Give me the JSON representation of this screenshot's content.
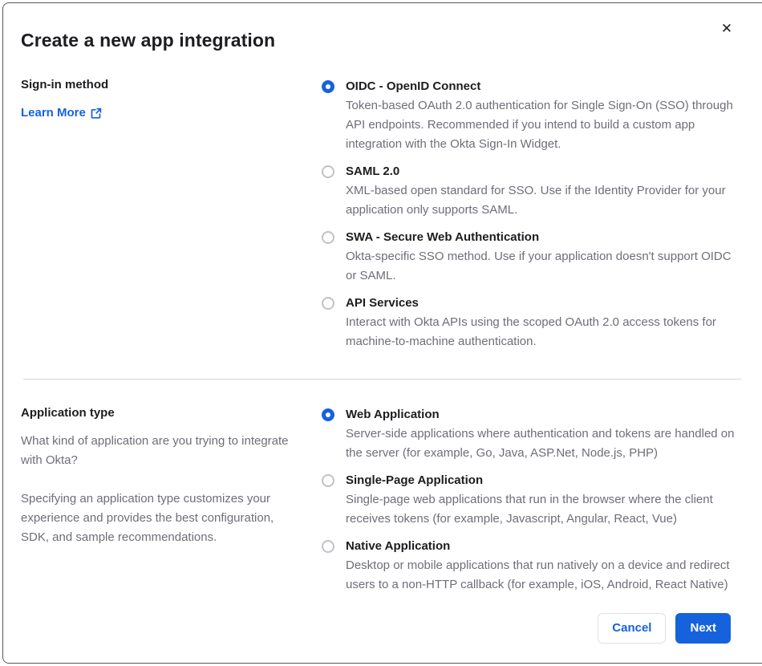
{
  "dialog": {
    "title": "Create a new app integration",
    "close_icon": "✕"
  },
  "colors": {
    "accent_blue": "#1662dd",
    "heading_text": "#1d1d21",
    "body_text": "#6e6e78",
    "divider": "#d7d7dc",
    "dialog_border": "#565660"
  },
  "signin": {
    "label": "Sign-in method",
    "learn_more_label": "Learn More",
    "options": [
      {
        "title": "OIDC - OpenID Connect",
        "description": "Token-based OAuth 2.0 authentication for Single Sign-On (SSO) through API endpoints. Recommended if you intend to build a custom app integration with the Okta Sign-In Widget.",
        "selected": true
      },
      {
        "title": "SAML 2.0",
        "description": "XML-based open standard for SSO. Use if the Identity Provider for your application only supports SAML.",
        "selected": false
      },
      {
        "title": "SWA - Secure Web Authentication",
        "description": "Okta-specific SSO method. Use if your application doesn't support OIDC or SAML.",
        "selected": false
      },
      {
        "title": "API Services",
        "description": "Interact with Okta APIs using the scoped OAuth 2.0 access tokens for machine-to-machine authentication.",
        "selected": false
      }
    ]
  },
  "apptype": {
    "label": "Application type",
    "description_1": "What kind of application are you trying to integrate with Okta?",
    "description_2": "Specifying an application type customizes your experience and provides the best configuration, SDK, and sample recommendations.",
    "options": [
      {
        "title": "Web Application",
        "description": "Server-side applications where authentication and tokens are handled on the server (for example, Go, Java, ASP.Net, Node.js, PHP)",
        "selected": true
      },
      {
        "title": "Single-Page Application",
        "description": "Single-page web applications that run in the browser where the client receives tokens (for example, Javascript, Angular, React, Vue)",
        "selected": false
      },
      {
        "title": "Native Application",
        "description": "Desktop or mobile applications that run natively on a device and redirect users to a non-HTTP callback (for example, iOS, Android, React Native)",
        "selected": false
      }
    ]
  },
  "footer": {
    "cancel_label": "Cancel",
    "next_label": "Next"
  }
}
